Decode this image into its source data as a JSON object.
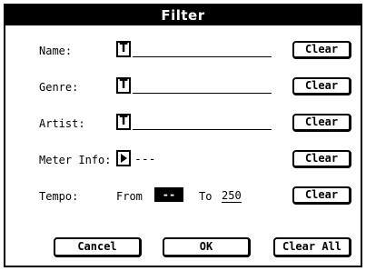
{
  "dialog": {
    "title": "Filter"
  },
  "fields": {
    "name": {
      "label": "Name:",
      "value": "",
      "clear_label": "Clear"
    },
    "genre": {
      "label": "Genre:",
      "value": "",
      "clear_label": "Clear"
    },
    "artist": {
      "label": "Artist:",
      "value": "",
      "clear_label": "Clear"
    },
    "meter": {
      "label": "Meter Info:",
      "value": "---",
      "clear_label": "Clear"
    },
    "tempo": {
      "label": "Tempo:",
      "from_label": "From",
      "from_value": "--",
      "to_label": "To",
      "to_value": "250",
      "clear_label": "Clear"
    }
  },
  "icons": {
    "text_edit": "T"
  },
  "footer": {
    "cancel_label": "Cancel",
    "ok_label": "OK",
    "clear_all_label": "Clear All"
  }
}
